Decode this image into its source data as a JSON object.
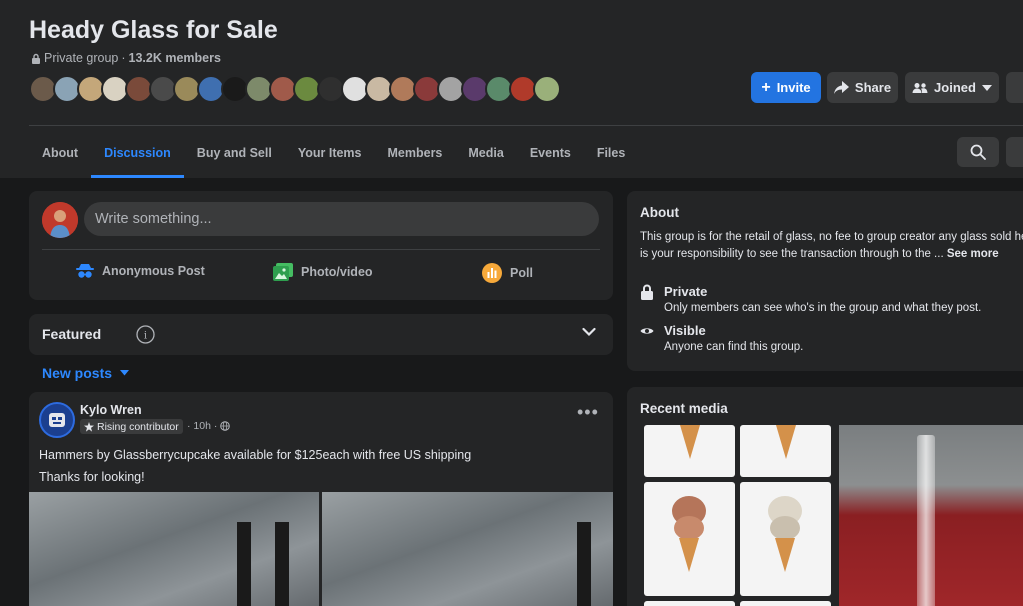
{
  "group": {
    "title": "Heady Glass for Sale",
    "privacy": "Private group",
    "separator": "·",
    "members": "13.2K members"
  },
  "actions": {
    "invite": "Invite",
    "share": "Share",
    "joined": "Joined"
  },
  "tabs": [
    {
      "label": "About"
    },
    {
      "label": "Discussion"
    },
    {
      "label": "Buy and Sell"
    },
    {
      "label": "Your Items"
    },
    {
      "label": "Members"
    },
    {
      "label": "Media"
    },
    {
      "label": "Events"
    },
    {
      "label": "Files"
    }
  ],
  "active_tab": "Discussion",
  "composer": {
    "placeholder": "Write something...",
    "anonymous": "Anonymous Post",
    "photo": "Photo/video",
    "poll": "Poll"
  },
  "featured": {
    "label": "Featured",
    "info": "i"
  },
  "feed": {
    "sort_label": "New posts"
  },
  "post": {
    "author": "Kylo Wren",
    "badge": "Rising contributor",
    "time": "· 10h ·",
    "text_line1": "Hammers by Glassberrycupcake available for $125each with free US shipping",
    "text_line2": "Thanks for looking!"
  },
  "about": {
    "title": "About",
    "description": "This group is for the retail of glass, no fee to group creator any glass sold here is your responsibility to see the transaction through to the ...",
    "see_more": "See more",
    "privacy_title": "Private",
    "privacy_desc": "Only members can see who's in the group and what they post.",
    "visibility_title": "Visible",
    "visibility_desc": "Anyone can find this group."
  },
  "recent_media": {
    "title": "Recent media"
  },
  "colors": {
    "accent": "#2d88ff",
    "invite_bg": "#2374e1",
    "card": "#242526",
    "page": "#18191a"
  }
}
